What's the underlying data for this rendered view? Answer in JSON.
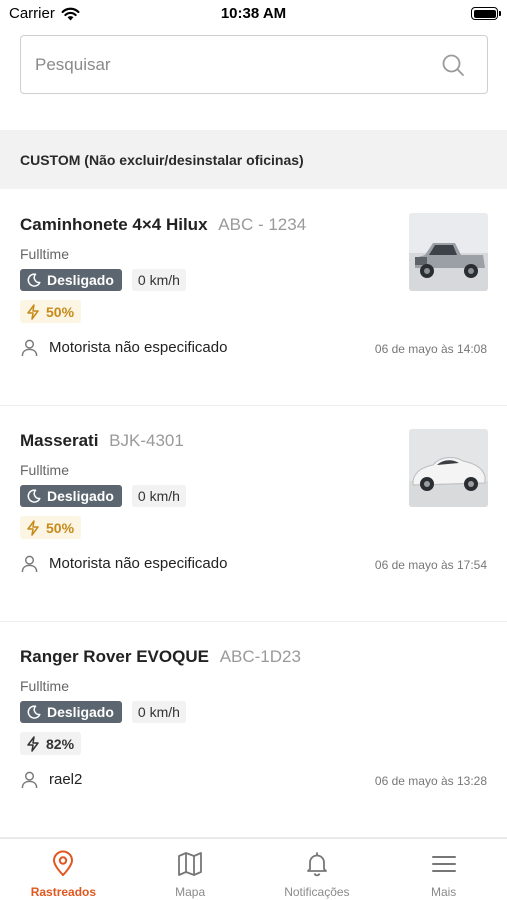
{
  "status_bar": {
    "carrier": "Carrier",
    "time": "10:38 AM"
  },
  "search": {
    "placeholder": "Pesquisar"
  },
  "group": {
    "title": "CUSTOM (Não excluir/desinstalar oficinas)"
  },
  "vehicles": [
    {
      "name": "Caminhonete 4×4 Hilux",
      "plate": "ABC - 1234",
      "mode": "Fulltime",
      "status": "Desligado",
      "speed": "0 km/h",
      "battery": "50%",
      "battery_level": 0.5,
      "driver": "Motorista não especificado",
      "timestamp": "06 de mayo às 14:08",
      "image": "pickup-truck"
    },
    {
      "name": "Masserati",
      "plate": "BJK-4301",
      "mode": "Fulltime",
      "status": "Desligado",
      "speed": "0 km/h",
      "battery": "50%",
      "battery_level": 0.5,
      "driver": "Motorista não especificado",
      "timestamp": "06 de mayo às 17:54",
      "image": "sports-car"
    },
    {
      "name": "Ranger Rover EVOQUE",
      "plate": "ABC-1D23",
      "mode": "Fulltime",
      "status": "Desligado",
      "speed": "0 km/h",
      "battery": "82%",
      "battery_level": 0.82,
      "driver": "rael2",
      "timestamp": "06 de mayo às 13:28",
      "image": ""
    }
  ],
  "tabs": [
    {
      "label": "Rastreados",
      "icon": "map-pin-icon",
      "active": true
    },
    {
      "label": "Mapa",
      "icon": "map-icon",
      "active": false
    },
    {
      "label": "Notificações",
      "icon": "bell-icon",
      "active": false
    },
    {
      "label": "Mais",
      "icon": "menu-icon",
      "active": false
    }
  ],
  "colors": {
    "accent": "#e2571f",
    "status_badge": "#5b6670",
    "battery_warning": "#c68a1a",
    "battery_warning_bg": "#fdf5e3",
    "group_header_bg": "#f2f2f2"
  }
}
